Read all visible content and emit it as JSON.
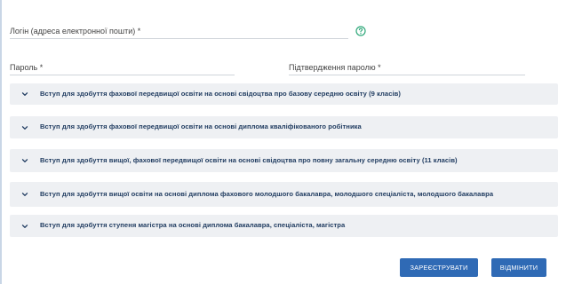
{
  "form": {
    "login_label": "Логін (адреса електронної пошти) *",
    "password_label": "Пароль *",
    "confirm_label": "Підтвердження паролю *"
  },
  "accordion": [
    {
      "title": "Вступ для здобуття фахової передвищої освіти на основі свідоцтва про базову середню освіту (9 класів)"
    },
    {
      "title": "Вступ для здобуття фахової передвищої освіти на основі диплома кваліфікованого робітника"
    },
    {
      "title": "Вступ для здобуття вищої, фахової передвищої освіти на основі свідоцтва про повну загальну середню освіту (11 класів)"
    },
    {
      "title": "Вступ для здобуття вищої освіти на основі диплома фахового молодшого бакалавра, молодшого спеціаліста, молодшого бакалавра"
    },
    {
      "title": "Вступ для здобуття ступеня магістра на основі диплома бакалавра, спеціаліста, магістра"
    }
  ],
  "buttons": {
    "register": "Зареєструвати",
    "cancel": "Відмінити"
  },
  "colors": {
    "accent": "#2f6ab5",
    "help_icon": "#2fa87a",
    "accordion_bg": "#eef0f3",
    "accordion_text": "#1e3a5f"
  },
  "icons": {
    "help": "question-circle-icon",
    "expand": "chevron-down-icon"
  }
}
